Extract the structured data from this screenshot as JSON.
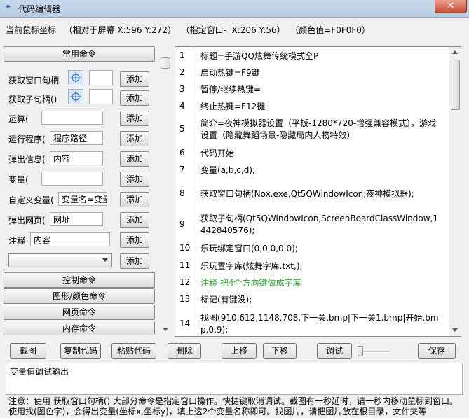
{
  "window": {
    "title": "代码编辑器",
    "close_label": "✕"
  },
  "coords": {
    "label": "当前鼠标坐标",
    "screen": "（相对于屏幕 X:596 Y:272）",
    "window": "（指定窗口-  X:206 Y:56）",
    "color": "（颜色值=F0F0F0）"
  },
  "left": {
    "common_header": "常用命令",
    "add_label": "添加",
    "commands": [
      {
        "label": "获取窗口句柄"
      },
      {
        "label": "获取子句柄()"
      },
      {
        "label": "运算(",
        "value": ""
      },
      {
        "label": "运行程序(",
        "value": "程序路径"
      },
      {
        "label": "弹出信息(",
        "value": "内容"
      },
      {
        "label": "变量(",
        "value": ""
      },
      {
        "label": "自定义变量(",
        "value": "变量名=变量"
      },
      {
        "label": "弹出网页(",
        "value": "网址"
      },
      {
        "label": "注释",
        "value": "内容"
      }
    ],
    "dropdown_value": "",
    "categories": [
      "控制命令",
      "图形/颜色命令",
      "网页命令",
      "内存命令"
    ]
  },
  "editor": {
    "lines": [
      {
        "num": "1",
        "text": "标题=手游QQ炫舞传统模式全P"
      },
      {
        "num": "2",
        "text": "启动热键=F9键"
      },
      {
        "num": "3",
        "text": "暂停/继续热键="
      },
      {
        "num": "4",
        "text": "终止热键=F12键"
      },
      {
        "num": "5",
        "text": "简介=夜神模拟器设置（平板-1280*720-增强兼容模式），游戏设置（隐藏舞蹈场景-隐藏局内人物特效）"
      },
      {
        "num": "6",
        "text": "代码开始"
      },
      {
        "num": "7",
        "text": "变量(a,b,c,d);"
      },
      {
        "num": "8",
        "text": "获取窗口句柄(Nox.exe,Qt5QWindowIcon,夜神模拟器);"
      },
      {
        "num": "9",
        "text": "获取子句柄(Qt5QWindowIcon,ScreenBoardClassWindow,1442840576);"
      },
      {
        "num": "10",
        "text": "乐玩绑定窗口(0,0,0,0,0);"
      },
      {
        "num": "11",
        "text": "乐玩置字库(炫舞字库.txt,);"
      },
      {
        "num": "12",
        "text": "注释 把4个方向键做成字库",
        "comment": true
      },
      {
        "num": "13",
        "text": "标记(有键没);"
      },
      {
        "num": "14",
        "text": "找图(910,612,1148,708,下一关.bmp|下一关1.bmp|开始.bmp,0.9);"
      }
    ]
  },
  "toolbar": {
    "screenshot": "截图",
    "copy": "复制代码",
    "paste": "粘贴代码",
    "delete": "删除",
    "move_up": "上移",
    "move_down": "下移",
    "debug": "调试",
    "save": "保存"
  },
  "output": {
    "text": "变量值调试输出"
  },
  "notes": {
    "line1": "注意：使用 获取窗口句柄() 大部分命令是指定窗口操作。快捷键取消调试。截图有一秒延时，请一秒内移动鼠标到窗口。",
    "line2": "使用找(图色字)，会得出变量(坐标x,坐标y)，填上这2个变量名称即可。找图片，请把图片放在根目录，文件夹等"
  }
}
